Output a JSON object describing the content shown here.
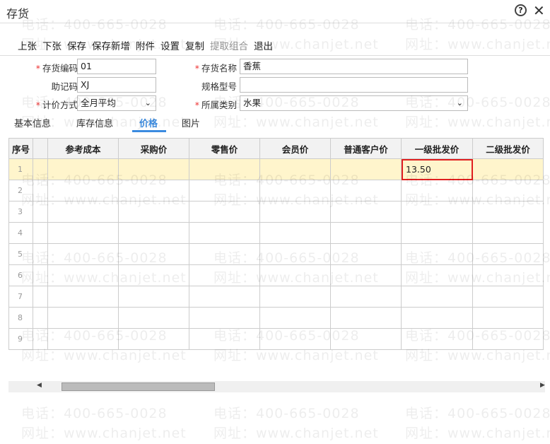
{
  "window": {
    "title": "存货"
  },
  "toolbar": [
    {
      "label": "上张"
    },
    {
      "label": "下张"
    },
    {
      "label": "保存"
    },
    {
      "label": "保存新增"
    },
    {
      "label": "附件"
    },
    {
      "label": "设置"
    },
    {
      "label": "复制"
    },
    {
      "label": "提取组合",
      "disabled": true
    },
    {
      "label": "退出"
    }
  ],
  "form": {
    "code": {
      "label": "存货编码",
      "value": "01"
    },
    "name": {
      "label": "存货名称",
      "value": "香蕉"
    },
    "mnemonic": {
      "label": "助记码",
      "value": "XJ"
    },
    "spec": {
      "label": "规格型号",
      "value": ""
    },
    "pricing": {
      "label": "计价方式",
      "value": "全月平均"
    },
    "category": {
      "label": "所属类别",
      "value": "水果"
    }
  },
  "tabs": [
    {
      "label": "基本信息"
    },
    {
      "label": "库存信息"
    },
    {
      "label": "价格",
      "active": true
    },
    {
      "label": "图片"
    }
  ],
  "grid": {
    "headers": [
      "序号",
      "",
      "参考成本",
      "采购价",
      "零售价",
      "会员价",
      "普通客户价",
      "一级批发价",
      "二级批发价"
    ],
    "rows": [
      [
        "1",
        "",
        "",
        "",
        "",
        "",
        "",
        "13.50",
        ""
      ],
      [
        "2"
      ],
      [
        "3"
      ],
      [
        "4"
      ],
      [
        "5"
      ],
      [
        "6"
      ],
      [
        "7"
      ],
      [
        "8"
      ],
      [
        "9"
      ]
    ]
  },
  "watermark": {
    "phone": "电话：400-665-0028",
    "site": "网址：www.chanjet.net"
  },
  "colors": {
    "accent": "#3b8be0",
    "selected_row": "#fff5cc",
    "highlight_border": "#e02020"
  }
}
